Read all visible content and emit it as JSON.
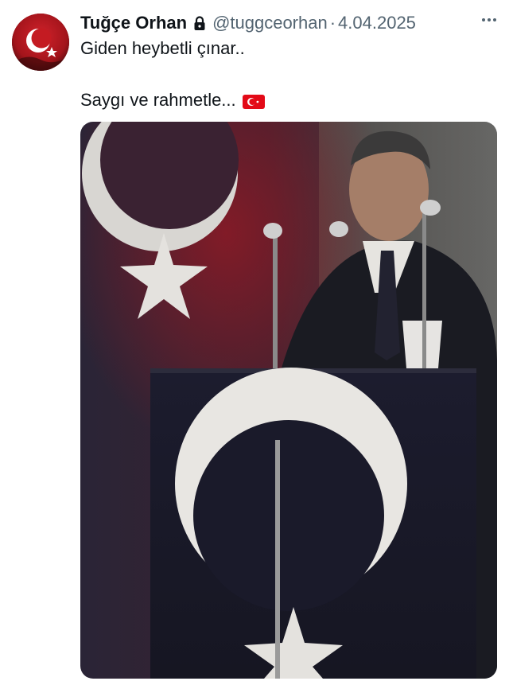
{
  "tweet": {
    "author": {
      "display_name": "Tuğçe Orhan",
      "handle": "@tuggceorhan",
      "protected_icon": "lock-icon"
    },
    "separator": "·",
    "date": "4.04.2025",
    "text_line_1": "Giden heybetli çınar..",
    "text_line_2": "Saygı ve rahmetle...",
    "emoji": "turkey-flag-emoji",
    "more_icon": "more-horizontal-icon"
  },
  "colors": {
    "text_primary": "#0f1419",
    "text_secondary": "#536471",
    "flag_red": "#e30a17"
  }
}
